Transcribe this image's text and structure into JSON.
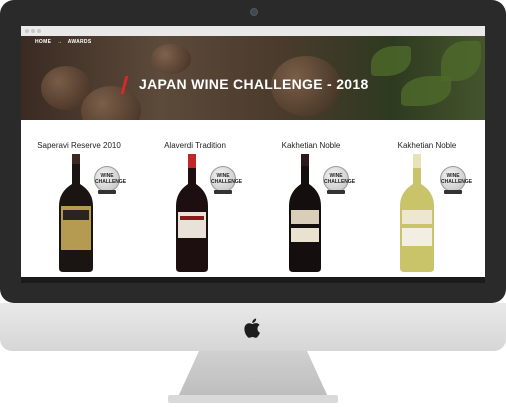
{
  "breadcrumb": {
    "home": "HOME",
    "separator": "→",
    "current": "AWARDS"
  },
  "hero": {
    "title": "JAPAN WINE CHALLENGE - 2018"
  },
  "colors": {
    "accent": "#d42a2a",
    "text": "#222222"
  },
  "medal": {
    "line1": "WINE",
    "line2": "CHALLENGE"
  },
  "products": [
    {
      "name": "Saperavi Reserve 2010",
      "bottle": "dark-red"
    },
    {
      "name": "Alaverdi Tradition",
      "bottle": "dark-red"
    },
    {
      "name": "Kakhetian Noble",
      "bottle": "dark-red"
    },
    {
      "name": "Kakhetian Noble",
      "bottle": "white-wine"
    }
  ]
}
